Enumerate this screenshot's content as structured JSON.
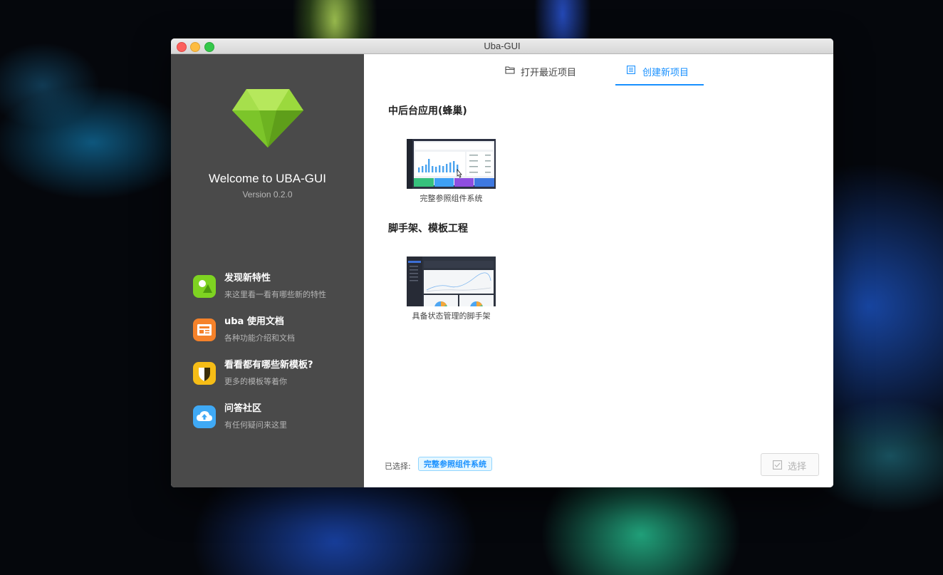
{
  "window": {
    "title": "Uba-GUI"
  },
  "sidebar": {
    "welcome": "Welcome to UBA-GUI",
    "version": "Version 0.2.0",
    "items": [
      {
        "title": "发现新特性",
        "desc": "来这里看一看有哪些新的特性",
        "icon": "picture-icon",
        "color": "#7ed321"
      },
      {
        "title": "uba 使用文档",
        "desc": "各种功能介绍和文档",
        "icon": "document-icon",
        "color": "#f5822a"
      },
      {
        "title": "看看都有哪些新模板?",
        "desc": "更多的模板等着你",
        "icon": "shield-icon",
        "color": "#f6bd16"
      },
      {
        "title": "问答社区",
        "desc": "有任何疑问来这里",
        "icon": "cloud-upload-icon",
        "color": "#3fa9f5"
      }
    ]
  },
  "tabs": [
    {
      "label": "打开最近项目",
      "icon": "folder-icon",
      "active": false
    },
    {
      "label": "创建新项目",
      "icon": "list-icon",
      "active": true
    }
  ],
  "sections": [
    {
      "title": "中后台应用(蜂巢)",
      "cards": [
        {
          "caption": "完整参照组件系统"
        }
      ]
    },
    {
      "title": "脚手架、模板工程",
      "cards": [
        {
          "caption": "具备状态管理的脚手架"
        }
      ]
    }
  ],
  "footer": {
    "selected_label": "已选择:",
    "selected_value": "完整参照组件系统",
    "select_button": "选择"
  },
  "colors": {
    "accent": "#1890ff",
    "sidebar_bg": "#4a4a4a",
    "gem": "#8fd134"
  }
}
